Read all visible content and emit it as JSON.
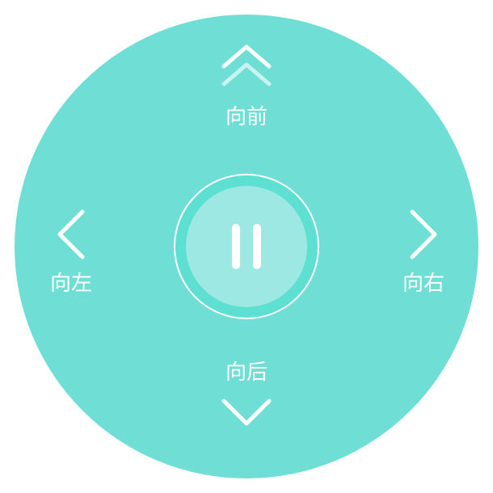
{
  "controls": {
    "forward_label": "向前",
    "backward_label": "向后",
    "left_label": "向左",
    "right_label": "向右"
  },
  "icons": {
    "forward": "double-chevron-up-icon",
    "backward": "chevron-down-icon",
    "left": "chevron-left-icon",
    "right": "chevron-right-icon",
    "pause": "pause-icon"
  },
  "colors": {
    "pad": "#6fdfd6",
    "pause_ring": "#5ddfd1",
    "pause_core": "#9de8e2",
    "foreground": "#ffffff"
  }
}
